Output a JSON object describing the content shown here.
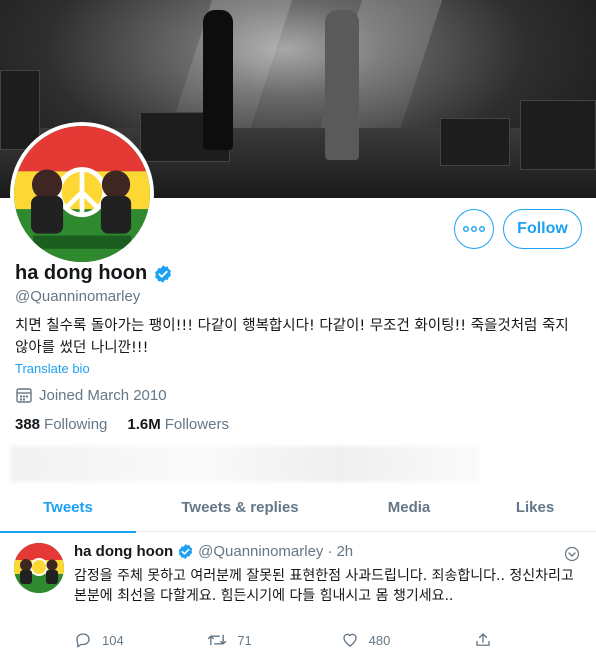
{
  "profile": {
    "display_name": "ha dong hoon",
    "handle": "@Quanninomarley",
    "bio": "치면 칠수록 돌아가는 팽이!!! 다같이 행복합시다! 다같이! 무조건 화이팅!! 죽을것처럼 죽지않아를 썼던 나니깐!!!",
    "translate_label": "Translate bio",
    "joined": "Joined March 2010",
    "following_count": "388",
    "following_label": "Following",
    "followers_count": "1.6M",
    "followers_label": "Followers"
  },
  "actions": {
    "more_icon": "more-horizontal-icon",
    "follow_label": "Follow"
  },
  "tabs": [
    {
      "label": "Tweets",
      "active": true
    },
    {
      "label": "Tweets & replies",
      "active": false
    },
    {
      "label": "Media",
      "active": false
    },
    {
      "label": "Likes",
      "active": false
    }
  ],
  "tweet": {
    "name": "ha dong hoon",
    "handle": "@Quanninomarley",
    "separator": "·",
    "time": "2h",
    "text": "감정을 주체 못하고 여러분께 잘못된 표현한점 사과드립니다. 죄송합니다.. 정신차리고 본분에 최선을 다할게요. 힘든시기에 다들 힘내시고 몸 챙기세요..",
    "reply_count": "104",
    "retweet_count": "71",
    "like_count": "480"
  },
  "colors": {
    "accent": "#1da1f2",
    "text": "#14171a",
    "secondary": "#657786",
    "border": "#e6ecf0"
  }
}
